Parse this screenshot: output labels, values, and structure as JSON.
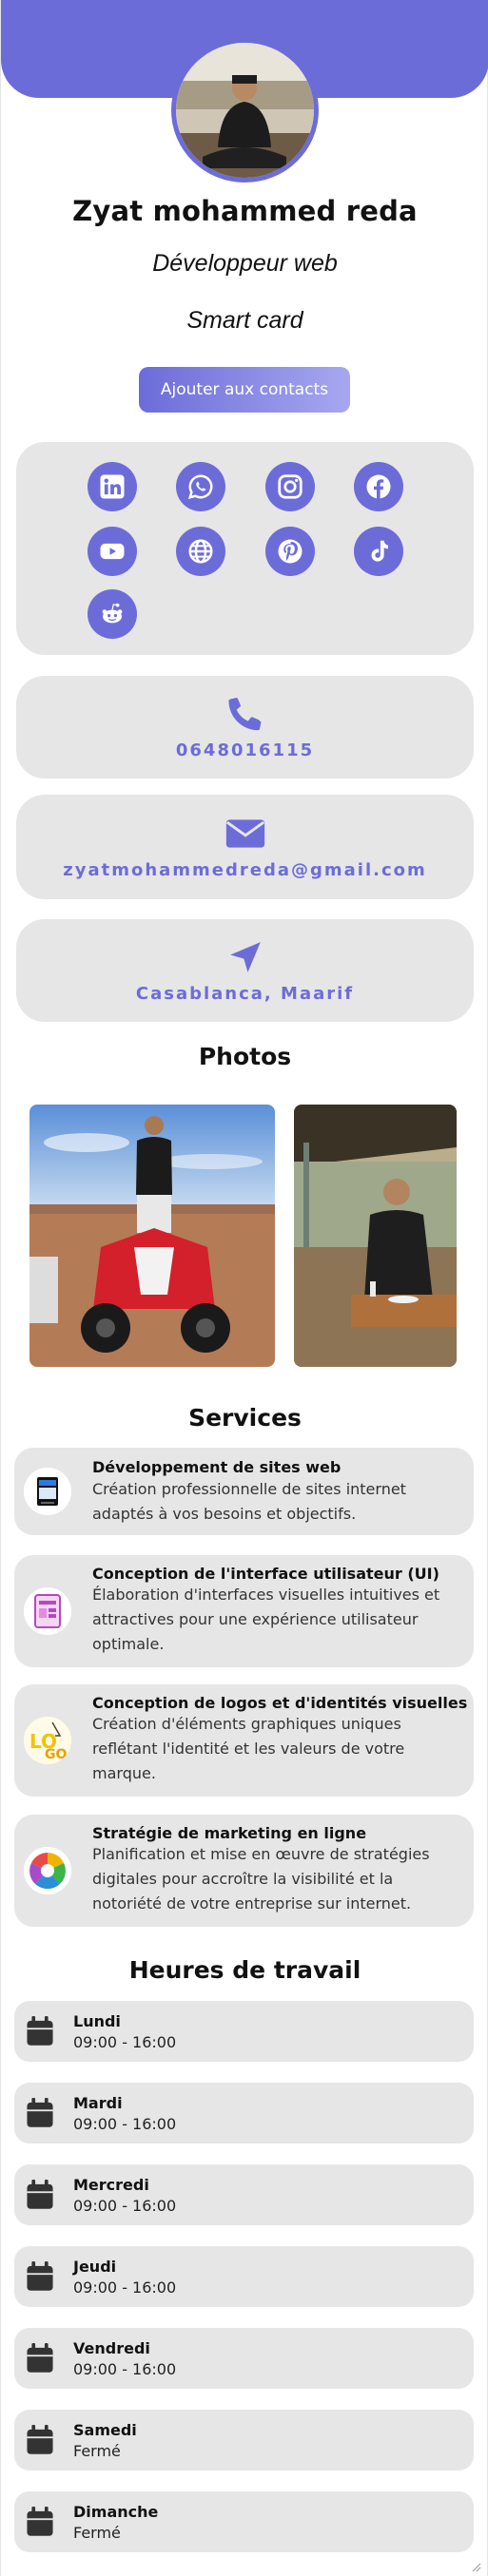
{
  "profile": {
    "name": "Zyat mohammed reda",
    "job": "Développeur web",
    "subtitle": "Smart card",
    "add_contact_label": "Ajouter aux contacts"
  },
  "social": [
    {
      "name": "linkedin-icon"
    },
    {
      "name": "whatsapp-icon"
    },
    {
      "name": "instagram-icon"
    },
    {
      "name": "facebook-icon"
    },
    {
      "name": "youtube-icon"
    },
    {
      "name": "website-globe-icon"
    },
    {
      "name": "pinterest-icon"
    },
    {
      "name": "tiktok-icon"
    },
    {
      "name": "reddit-icon"
    }
  ],
  "contact": {
    "phone": "0648016115",
    "email": "zyatmohammedreda@gmail.com",
    "location": "Casablanca, Maarif"
  },
  "photos_title": "Photos",
  "services_title": "Services",
  "services": [
    {
      "title": "Développement de sites web",
      "desc": "Création professionnelle de sites internet adaptés à vos besoins et objectifs."
    },
    {
      "title": "Conception de l'interface utilisateur (UI)",
      "desc": "Élaboration d'interfaces visuelles intuitives et attractives pour une expérience utilisateur optimale."
    },
    {
      "title": "Conception de logos et d'identités visuelles",
      "desc": "Création d'éléments graphiques uniques reflétant l'identité et les valeurs de votre marque."
    },
    {
      "title": "Stratégie de marketing en ligne",
      "desc": "Planification et mise en œuvre de stratégies digitales pour accroître la visibilité et la notoriété de votre entreprise sur internet."
    }
  ],
  "hours_title": "Heures de travail",
  "hours": [
    {
      "day": "Lundi",
      "time": "09:00 - 16:00"
    },
    {
      "day": "Mardi",
      "time": "09:00 - 16:00"
    },
    {
      "day": "Mercredi",
      "time": "09:00 - 16:00"
    },
    {
      "day": "Jeudi",
      "time": "09:00 - 16:00"
    },
    {
      "day": "Vendredi",
      "time": "09:00 - 16:00"
    },
    {
      "day": "Samedi",
      "time": "Fermé"
    },
    {
      "day": "Dimanche",
      "time": "Fermé"
    }
  ],
  "colors": {
    "accent": "#6c6cd9",
    "card": "#e6e6e7"
  }
}
